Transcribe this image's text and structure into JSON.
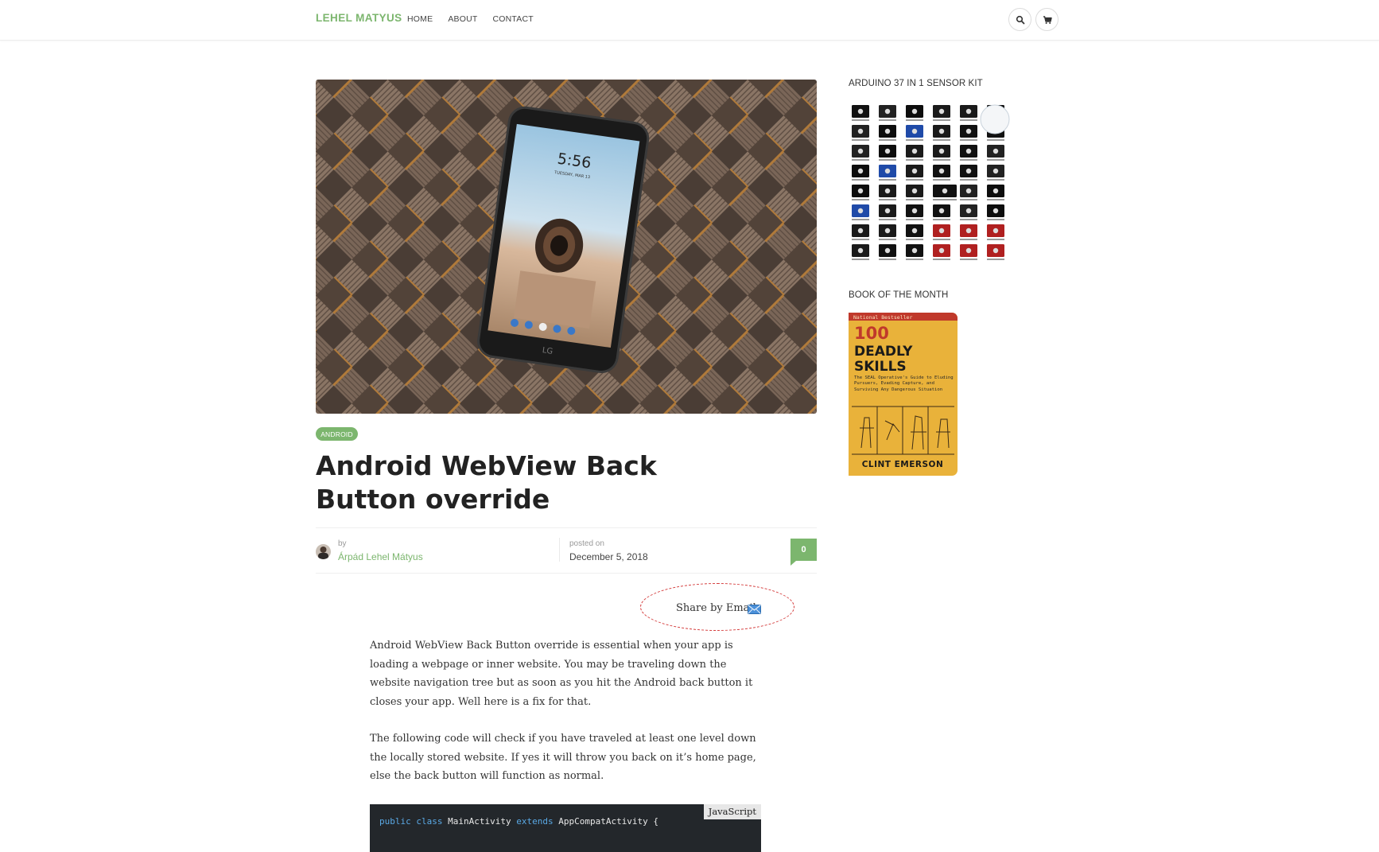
{
  "header": {
    "brand": "LEHEL MATYUS",
    "nav": [
      "HOME",
      "ABOUT",
      "CONTACT"
    ],
    "icons": [
      "search-icon",
      "cart-icon"
    ]
  },
  "hero": {
    "phone_time": "5:56",
    "phone_date": "TUESDAY, MAR 13",
    "phone_brand": "LG"
  },
  "post": {
    "category": "ANDROID",
    "title": "Android WebView Back Button override",
    "by_label": "by",
    "author": "Árpád Lehel Mátyus",
    "posted_label": "posted on",
    "date": "December 5, 2018",
    "comment_count": "0",
    "share_label": "Share by Email",
    "paragraphs": [
      "Android WebView Back Button override is essential when your app is loading a webpage or inner website. You may be traveling down the website navigation tree but as soon as you hit the Android back button it closes your app. Well here is a fix for that.",
      "The following code will check if you have traveled at least one level down the locally stored website. If yes it will throw you back on it’s home page, else the back button will function as normal."
    ],
    "code": {
      "language": "JavaScript",
      "tokens": [
        "public",
        "class",
        "MainActivity",
        "extends",
        "AppCompatActivity {"
      ]
    }
  },
  "sidebar": {
    "widget1_title": "ARDUINO 37 IN 1 SENSOR KIT",
    "widget2_title": "BOOK OF THE MONTH",
    "book": {
      "top_banner": "National Bestseller",
      "title_line1": "100",
      "title_line2": "DEADLY",
      "title_line3": "SKILLS",
      "subtitle": "The SEAL Operative's Guide to Eluding Pursuers, Evading Capture, and Surviving Any Dangerous Situation",
      "author": "CLINT EMERSON"
    }
  },
  "colors": {
    "accent": "#7cb66e",
    "annotation": "#d43b3b",
    "code_bg": "#23272b"
  }
}
